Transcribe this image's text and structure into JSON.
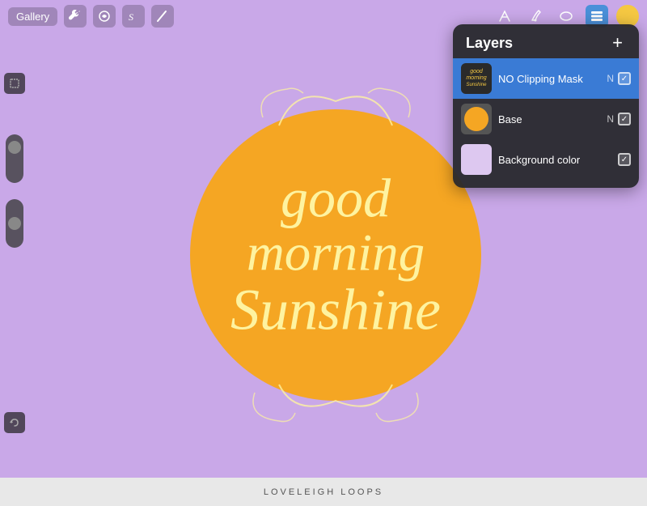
{
  "toolbar": {
    "gallery_label": "Gallery",
    "tools": [
      {
        "name": "wrench-icon",
        "symbol": "⚙"
      },
      {
        "name": "adjust-icon",
        "symbol": "✦"
      },
      {
        "name": "brush-icon",
        "symbol": "S"
      },
      {
        "name": "smudge-icon",
        "symbol": "/"
      }
    ],
    "right_tools": [
      {
        "name": "pen-tool-icon",
        "symbol": "/"
      },
      {
        "name": "ink-tool-icon",
        "symbol": "✒"
      },
      {
        "name": "eraser-tool-icon",
        "symbol": "◯"
      },
      {
        "name": "layers-panel-icon",
        "symbol": "■",
        "active": true
      }
    ]
  },
  "canvas": {
    "background_color": "#c9a8e8",
    "sun_color": "#f5a623",
    "text_color": "#fef3a0",
    "lettering_line1": "good",
    "lettering_line2": "morning",
    "lettering_line3": "Sunshine"
  },
  "layers_panel": {
    "title": "Layers",
    "add_button_label": "+",
    "items": [
      {
        "id": "layer-1",
        "name": "NO Clipping Mask",
        "mode": "N",
        "visible": true,
        "active": true,
        "thumbnail_type": "clipping"
      },
      {
        "id": "layer-2",
        "name": "Base",
        "mode": "N",
        "visible": true,
        "active": false,
        "thumbnail_type": "circle_orange"
      },
      {
        "id": "layer-3",
        "name": "Background color",
        "mode": "",
        "visible": true,
        "active": false,
        "thumbnail_type": "bg_lavender"
      }
    ]
  },
  "bottom_bar": {
    "text": "LOVELEIGH LOOPS"
  },
  "left_sidebar": {
    "tools": [
      {
        "name": "modify-tool",
        "symbol": "□"
      },
      {
        "name": "slider-top",
        "symbol": "—"
      },
      {
        "name": "slider-bottom",
        "symbol": "—"
      },
      {
        "name": "undo-tool",
        "symbol": "↩"
      }
    ]
  }
}
